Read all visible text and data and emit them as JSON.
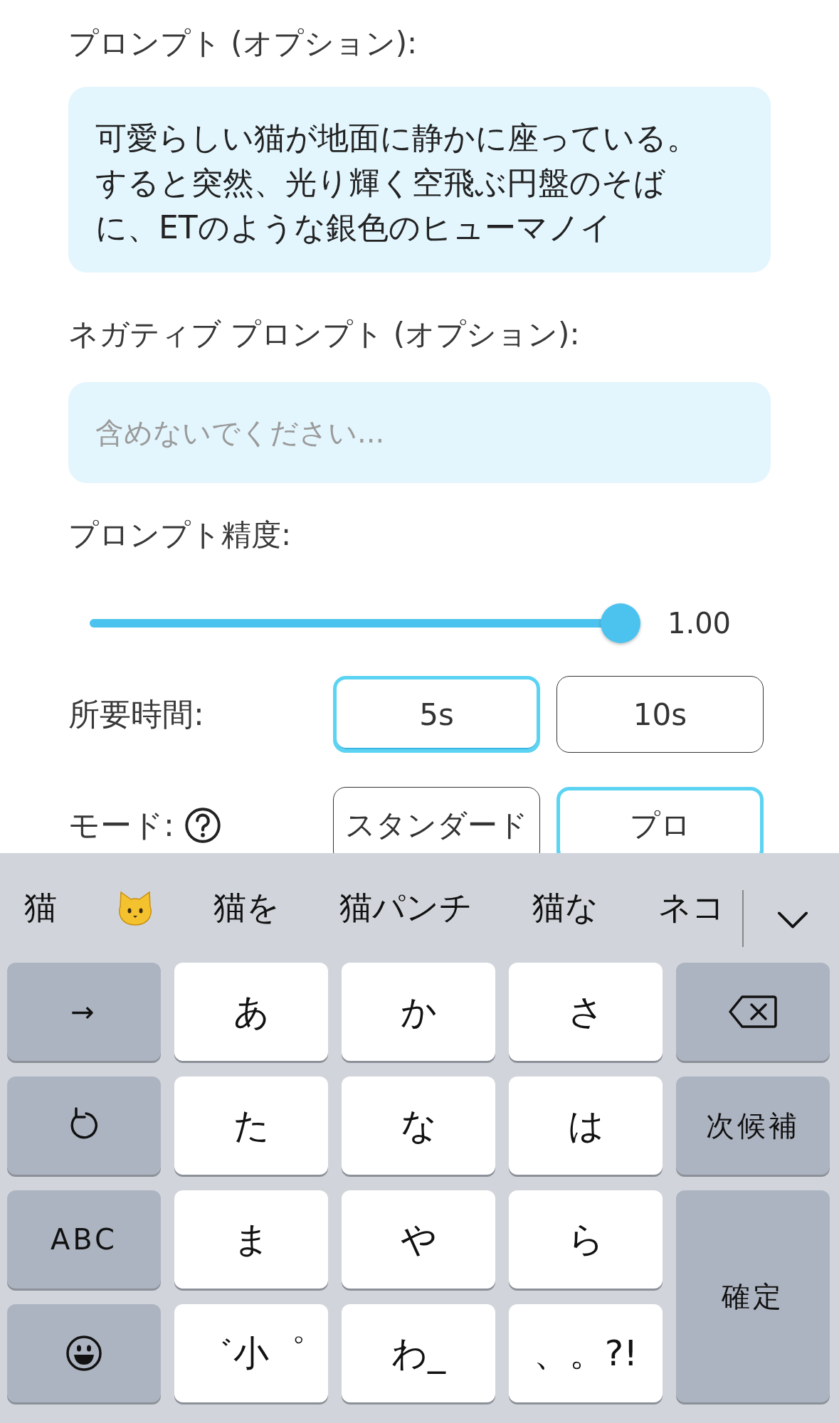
{
  "prompt": {
    "label": "プロンプト (オプション):",
    "value": "可愛らしい猫が地面に静かに座っている。すると突然、光り輝く空飛ぶ円盤のそばに、ETのような銀色のヒューマノイ"
  },
  "negative_prompt": {
    "label": "ネガティブ プロンプト (オプション):",
    "placeholder": "含めないでください..."
  },
  "precision": {
    "label": "プロンプト精度:",
    "level": 1.0,
    "reading": "1.00"
  },
  "duration": {
    "label": "所要時間:",
    "options": [
      {
        "label": "5s",
        "selected": true
      },
      {
        "label": "10s",
        "selected": false
      }
    ]
  },
  "mode": {
    "label": "モード:",
    "options": [
      {
        "label": "スタンダード",
        "selected": false
      },
      {
        "label": "プロ",
        "selected": true
      }
    ]
  },
  "keyboard": {
    "suggestions": [
      {
        "kind": "text",
        "label": "猫"
      },
      {
        "kind": "emoji"
      },
      {
        "kind": "text",
        "label": "猫を"
      },
      {
        "kind": "text",
        "label": "猫パンチ"
      },
      {
        "kind": "text",
        "label": "猫な"
      },
      {
        "kind": "text",
        "label": "ネコ"
      }
    ],
    "keys": [
      {
        "kind": "func",
        "label": "→"
      },
      {
        "kind": "char",
        "label": "あ"
      },
      {
        "kind": "char",
        "label": "か"
      },
      {
        "kind": "char",
        "label": "さ"
      },
      {
        "kind": "backspace"
      },
      {
        "kind": "undo"
      },
      {
        "kind": "char",
        "label": "た"
      },
      {
        "kind": "char",
        "label": "な"
      },
      {
        "kind": "char",
        "label": "は"
      },
      {
        "kind": "func",
        "label": "次候補"
      },
      {
        "kind": "func",
        "label": "ABC"
      },
      {
        "kind": "char",
        "label": "ま"
      },
      {
        "kind": "char",
        "label": "や"
      },
      {
        "kind": "char",
        "label": "ら"
      },
      {
        "kind": "tall",
        "label": "確定"
      },
      {
        "kind": "emoji"
      },
      {
        "kind": "char",
        "label": "゛小゜"
      },
      {
        "kind": "char",
        "label": "わ_"
      },
      {
        "kind": "char",
        "label": "、。?!"
      }
    ]
  }
}
